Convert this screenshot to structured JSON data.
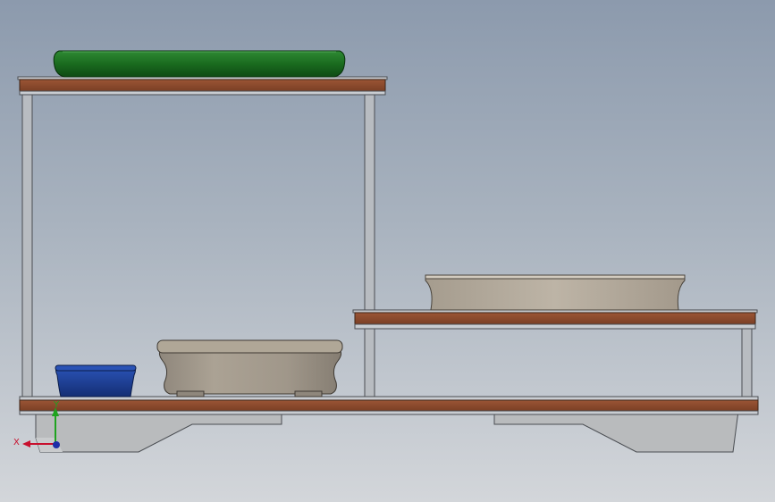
{
  "viewport": {
    "background_top": "#8c9aad",
    "background_bottom": "#d3d6da"
  },
  "colors": {
    "wood": "#8a4a2e",
    "frame": "#c9cdd2",
    "post": "#b8bcc1",
    "base": "#b9bbbd",
    "pot_green": "#1a6b1f",
    "pot_blue": "#1d3f97",
    "pot_stone": "#a59c90",
    "tray_stone": "#b3aa9c",
    "axis_x": "#c8102e",
    "axis_y": "#1fa31f",
    "axis_z": "#1d2fa8"
  },
  "triad": {
    "x_label": "X",
    "y_label": "Y"
  }
}
